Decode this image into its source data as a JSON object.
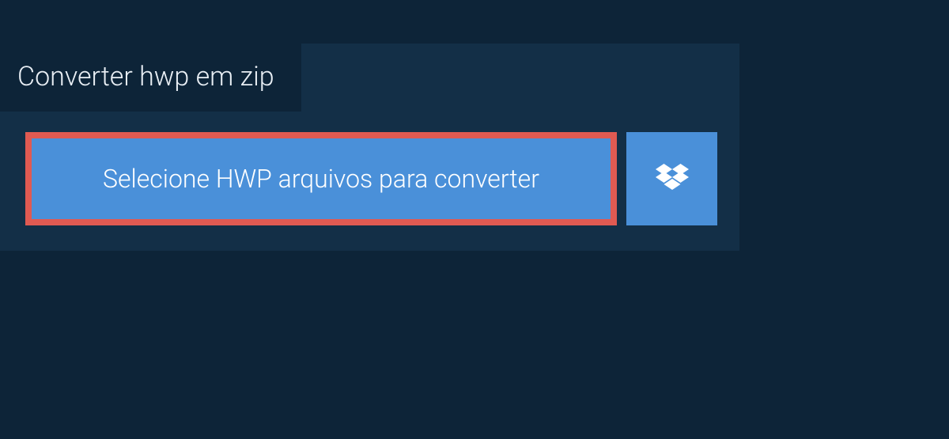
{
  "tab": {
    "title": "Converter hwp em zip"
  },
  "buttons": {
    "select_label": "Selecione HWP arquivos para converter"
  },
  "colors": {
    "bg": "#0d2438",
    "panel": "#132f47",
    "button": "#4a90d9",
    "highlight_border": "#e05a52",
    "text": "#ffffff"
  }
}
